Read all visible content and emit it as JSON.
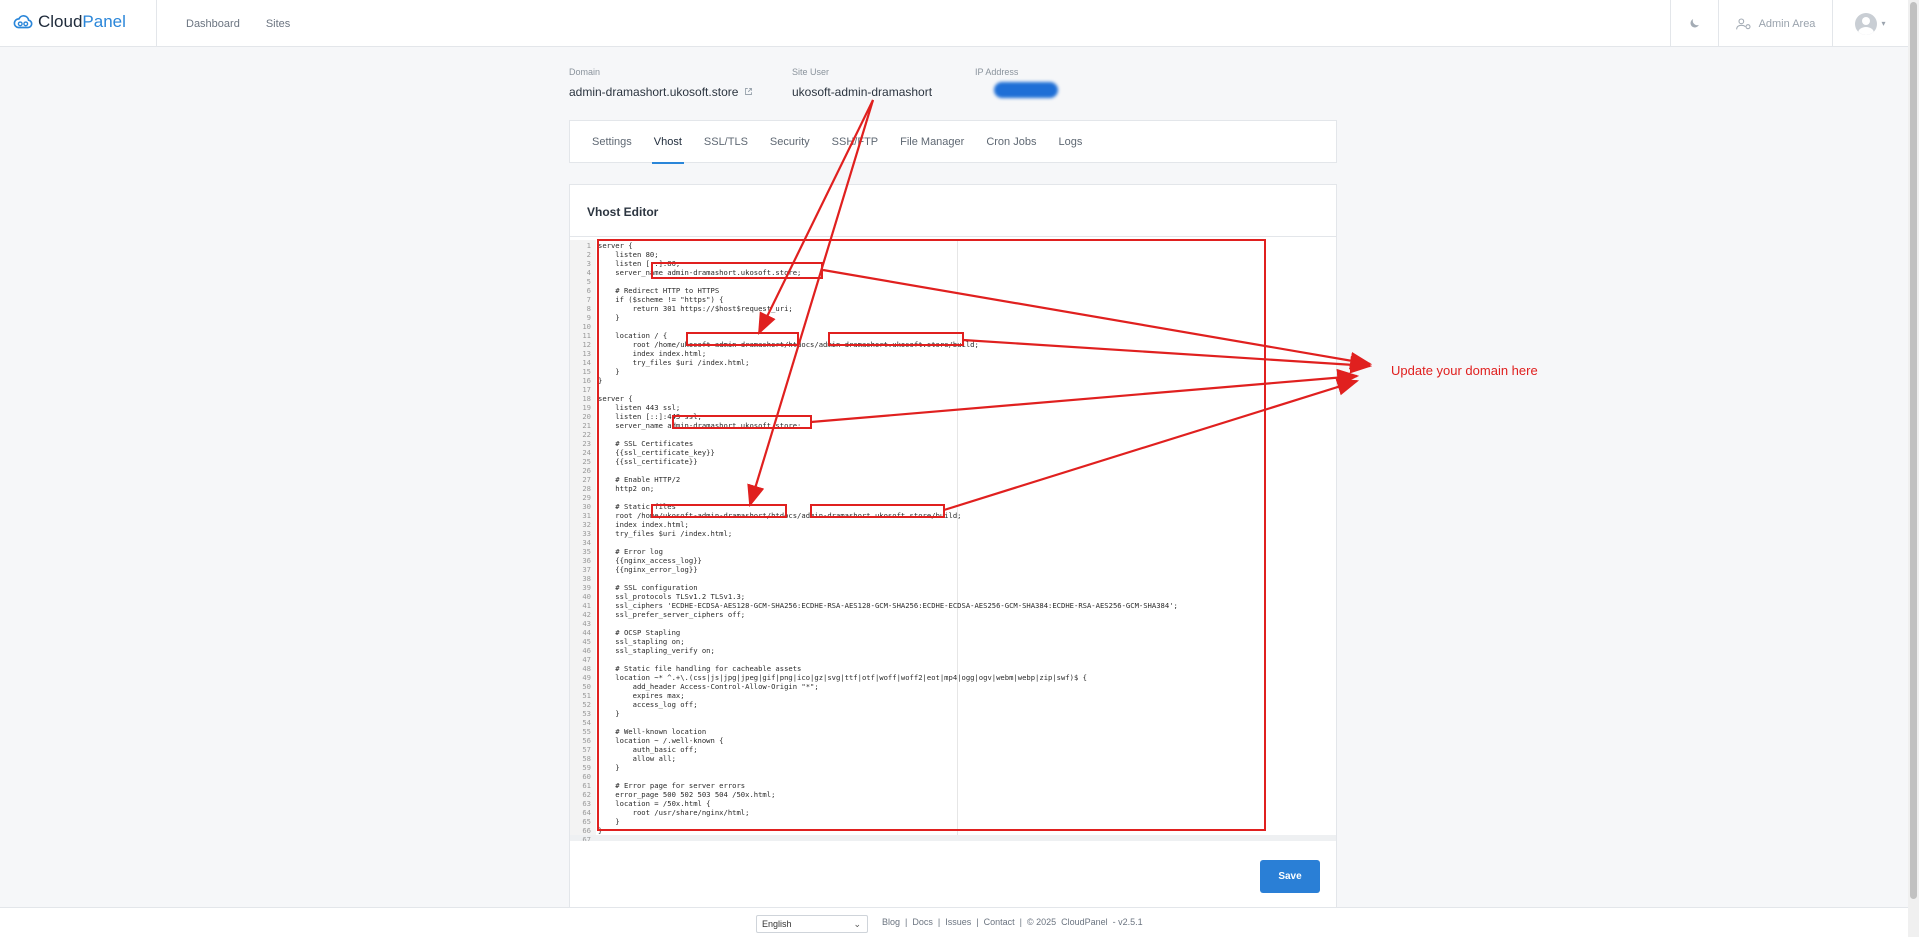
{
  "brand": {
    "name_part1": "Cloud",
    "name_part2": "Panel"
  },
  "nav": {
    "items": [
      "Dashboard",
      "Sites"
    ]
  },
  "topbar": {
    "admin_label": "Admin Area",
    "moon_icon": "moon-icon",
    "admin_icon": "admin-gear-icon"
  },
  "site": {
    "domain_label": "Domain",
    "domain_value": "admin-dramashort.ukosoft.store",
    "site_user_label": "Site User",
    "site_user_value": "ukosoft-admin-dramashort",
    "ip_label": "IP Address"
  },
  "tabs": [
    "Settings",
    "Vhost",
    "SSL/TLS",
    "Security",
    "SSH/FTP",
    "File Manager",
    "Cron Jobs",
    "Logs"
  ],
  "active_tab": "Vhost",
  "editor": {
    "title": "Vhost Editor",
    "lines": [
      "server {",
      "    listen 80;",
      "    listen [::]:80;",
      "    server_name admin-dramashort.ukosoft.store;",
      "",
      "    # Redirect HTTP to HTTPS",
      "    if ($scheme != \"https\") {",
      "        return 301 https://$host$request_uri;",
      "    }",
      "",
      "    location / {",
      "        root /home/ukosoft-admin-dramashort/htdocs/admin-dramashort.ukosoft.store/build;",
      "        index index.html;",
      "        try_files $uri /index.html;",
      "    }",
      "}",
      "",
      "server {",
      "    listen 443 ssl;",
      "    listen [::]:443 ssl;",
      "    server_name admin-dramashort.ukosoft.store;",
      "",
      "    # SSL Certificates",
      "    {{ssl_certificate_key}}",
      "    {{ssl_certificate}}",
      "",
      "    # Enable HTTP/2",
      "    http2 on;",
      "",
      "    # Static files",
      "    root /home/ukosoft-admin-dramashort/htdocs/admin-dramashort.ukosoft.store/build;",
      "    index index.html;",
      "    try_files $uri /index.html;",
      "",
      "    # Error log",
      "    {{nginx_access_log}}",
      "    {{nginx_error_log}}",
      "",
      "    # SSL configuration",
      "    ssl_protocols TLSv1.2 TLSv1.3;",
      "    ssl_ciphers 'ECDHE-ECDSA-AES128-GCM-SHA256:ECDHE-RSA-AES128-GCM-SHA256:ECDHE-ECDSA-AES256-GCM-SHA384:ECDHE-RSA-AES256-GCM-SHA384';",
      "    ssl_prefer_server_ciphers off;",
      "",
      "    # OCSP Stapling",
      "    ssl_stapling on;",
      "    ssl_stapling_verify on;",
      "",
      "    # Static file handling for cacheable assets",
      "    location ~* ^.+\\.(css|js|jpg|jpeg|gif|png|ico|gz|svg|ttf|otf|woff|woff2|eot|mp4|ogg|ogv|webm|webp|zip|swf)$ {",
      "        add_header Access-Control-Allow-Origin \"*\";",
      "        expires max;",
      "        access_log off;",
      "    }",
      "",
      "    # Well-known location",
      "    location ~ /.well-known {",
      "        auth_basic off;",
      "        allow all;",
      "    }",
      "",
      "    # Error page for server errors",
      "    error_page 500 502 503 504 /50x.html;",
      "    location = /50x.html {",
      "        root /usr/share/nginx/html;",
      "    }",
      "}",
      ""
    ],
    "save_label": "Save"
  },
  "annotation": {
    "text": "Update your domain here",
    "color": "#e0201f"
  },
  "footer": {
    "language": "English",
    "links": [
      "Blog",
      "Docs",
      "Issues",
      "Contact"
    ],
    "copyright": "© 2025",
    "product": "CloudPanel",
    "version": "- v2.5.1"
  },
  "colors": {
    "accent": "#2a86d9",
    "save_button": "#2a7fd6",
    "annotation_red": "#e0201f"
  }
}
